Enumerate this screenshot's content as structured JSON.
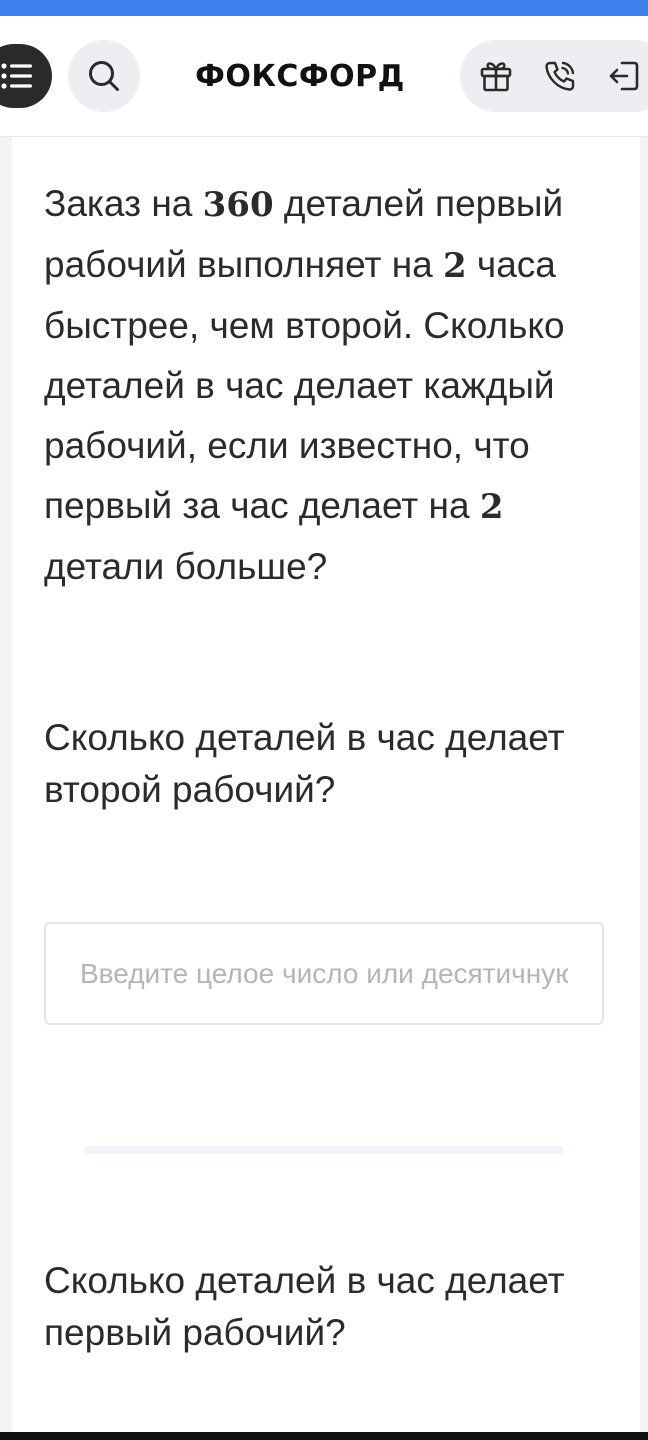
{
  "header": {
    "logo": "ФОКСФОРД",
    "menu_icon": "list-menu-icon",
    "search_icon": "search-icon",
    "actions": [
      {
        "name": "gift-icon"
      },
      {
        "name": "phone-icon"
      },
      {
        "name": "login-icon"
      }
    ]
  },
  "problem": {
    "part1": "Заказ на ",
    "num1": "360",
    "part2": " деталей первый рабочий выполняет на ",
    "num2": "2",
    "part3": " часа быстрее, чем второй. Сколько деталей в час делает каждый рабочий, если известно, что первый за час делает на ",
    "num3": "2",
    "part4": " детали больше?"
  },
  "questions": [
    {
      "text": "Сколько деталей в час делает второй рабочий?",
      "input_value": "",
      "input_placeholder": "Введите целое число или десятичную дробь"
    },
    {
      "text": "Сколько деталей в час делает первый рабочий?"
    }
  ],
  "colors": {
    "top_stripe": "#3f82ee",
    "menu_button": "#2a2a2a",
    "pill_background": "#eceef1",
    "text": "#2b2b2b",
    "placeholder": "#b3b5ba"
  }
}
